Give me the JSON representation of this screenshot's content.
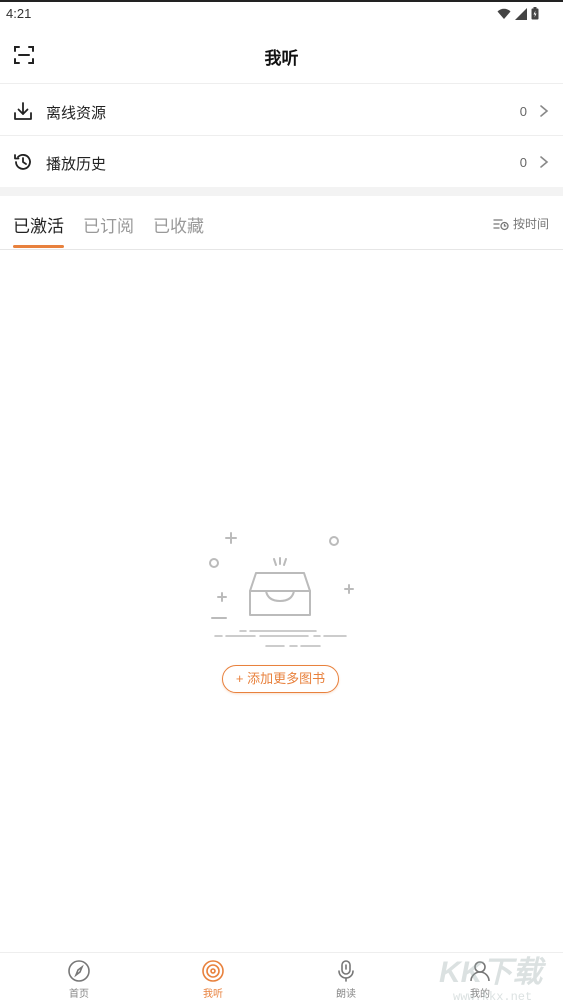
{
  "status_bar": {
    "time": "4:21"
  },
  "header": {
    "title": "我听"
  },
  "rows": {
    "offline": {
      "label": "离线资源",
      "count": "0"
    },
    "history": {
      "label": "播放历史",
      "count": "0"
    }
  },
  "tabs": [
    {
      "label": "已激活"
    },
    {
      "label": "已订阅"
    },
    {
      "label": "已收藏"
    }
  ],
  "sort": {
    "label": "按时间"
  },
  "empty": {
    "button_label": "+ 添加更多图书"
  },
  "bottom_nav": [
    {
      "label": "首页",
      "icon": "compass-icon"
    },
    {
      "label": "我听",
      "icon": "record-icon"
    },
    {
      "label": "朗读",
      "icon": "microphone-icon"
    },
    {
      "label": "我的",
      "icon": "user-icon"
    }
  ],
  "colors": {
    "accent": "#e8813d",
    "divider": "#eeeeee",
    "section_bg": "#f3f3f3"
  }
}
